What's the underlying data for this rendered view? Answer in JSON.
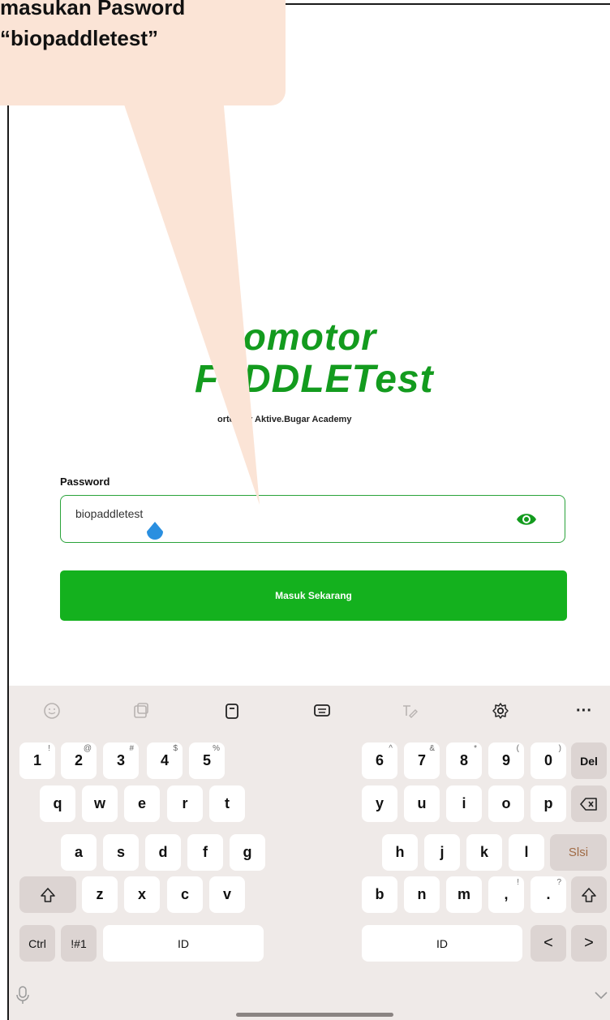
{
  "callout": {
    "line1": "masukan Pasword",
    "line2": "“biopaddletest”"
  },
  "app": {
    "logo_line1": "iomotor",
    "logo_line2": "DDLETest",
    "logo_prefix2": "F",
    "supported_text": "orted by Aktive.Bugar Academy",
    "password_label": "Password",
    "password_value": "biopaddletest",
    "submit_label": "Masuk Sekarang",
    "accent_color": "#14b11e"
  },
  "keyboard": {
    "toolbar_icons": [
      "emoji-icon",
      "sticker-icon",
      "clipboard-icon",
      "keyboard-mode-icon",
      "handwriting-icon",
      "gear-icon",
      "more-icon"
    ],
    "more_label": "···",
    "row1_left": [
      {
        "k": "1",
        "h": "!"
      },
      {
        "k": "2",
        "h": "@"
      },
      {
        "k": "3",
        "h": "#"
      },
      {
        "k": "4",
        "h": "$"
      },
      {
        "k": "5",
        "h": "%"
      }
    ],
    "row1_right": [
      {
        "k": "6",
        "h": "^"
      },
      {
        "k": "7",
        "h": "&"
      },
      {
        "k": "8",
        "h": "*"
      },
      {
        "k": "9",
        "h": "("
      },
      {
        "k": "0",
        "h": ")"
      }
    ],
    "del_label": "Del",
    "row2_left": [
      "q",
      "w",
      "e",
      "r",
      "t"
    ],
    "row2_right": [
      "y",
      "u",
      "i",
      "o",
      "p"
    ],
    "row3_left": [
      "a",
      "s",
      "d",
      "f",
      "g"
    ],
    "row3_right": [
      "h",
      "j",
      "k",
      "l"
    ],
    "slsi_label": "Slsi",
    "row4_left": [
      "z",
      "x",
      "c",
      "v"
    ],
    "row4_right": [
      {
        "k": "b",
        "h": ""
      },
      {
        "k": "n",
        "h": ""
      },
      {
        "k": "m",
        "h": ""
      },
      {
        "k": ",",
        "h": "!"
      },
      {
        "k": ".",
        "h": "?"
      }
    ],
    "ctrl_label": "Ctrl",
    "sym_label": "!#1",
    "space_left_label": "ID",
    "space_right_label": "ID",
    "arrow_left": "<",
    "arrow_right": ">"
  }
}
